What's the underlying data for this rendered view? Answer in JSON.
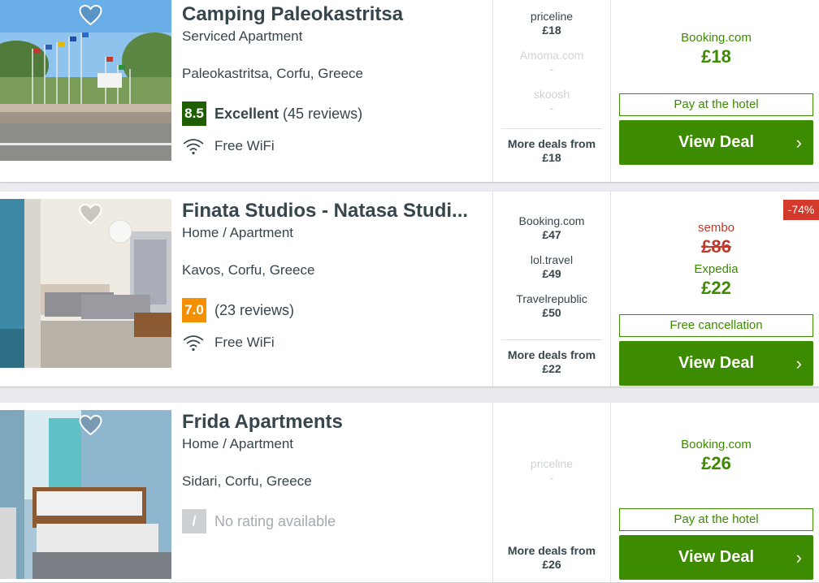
{
  "hotels": [
    {
      "name": "Camping Paleokastritsa",
      "type": "Serviced Apartment",
      "location": "Paleokastritsa, Corfu, Greece",
      "score": "8.5",
      "rating_label": "Excellent",
      "reviews": "(45 reviews)",
      "amenity": "Free WiFi",
      "deals": [
        {
          "provider": "priceline",
          "price": "£18"
        },
        {
          "provider": "Amoma.com",
          "price": "-"
        },
        {
          "provider": "skoosh",
          "price": "-"
        }
      ],
      "more_label": "More deals from",
      "more_price": "£18",
      "best_provider": "Booking.com",
      "best_price": "£18",
      "note": "Pay at the hotel",
      "button": "View Deal"
    },
    {
      "name": "Finata Studios - Natasa Studi...",
      "type": "Home / Apartment",
      "location": "Kavos, Corfu, Greece",
      "score": "7.0",
      "reviews": "(23 reviews)",
      "amenity": "Free WiFi",
      "deals": [
        {
          "provider": "Booking.com",
          "price": "£47"
        },
        {
          "provider": "lol.travel",
          "price": "£49"
        },
        {
          "provider": "Travelrepublic",
          "price": "£50"
        }
      ],
      "more_label": "More deals from",
      "more_price": "£22",
      "discount": "-74%",
      "old_provider": "sembo",
      "old_price": "£86",
      "best_provider": "Expedia",
      "best_price": "£22",
      "note": "Free cancellation",
      "button": "View Deal"
    },
    {
      "name": "Frida Apartments",
      "type": "Home / Apartment",
      "location": "Sidari, Corfu, Greece",
      "score": "/",
      "rating_na": "No rating available",
      "deals": [
        {
          "provider": "priceline",
          "price": "-"
        }
      ],
      "more_label": "More deals from",
      "more_price": "£26",
      "best_provider": "Booking.com",
      "best_price": "£26",
      "note": "Pay at the hotel",
      "button": "View Deal"
    }
  ],
  "icons": {
    "favorite": "heart-icon",
    "wifi": "wifi-icon",
    "chevron": "chevron-right-icon"
  },
  "colors": {
    "deal_green": "#3d8b00",
    "score_excellent": "#205f00",
    "score_good": "#f48f00",
    "discount_red": "#d33a2c"
  }
}
